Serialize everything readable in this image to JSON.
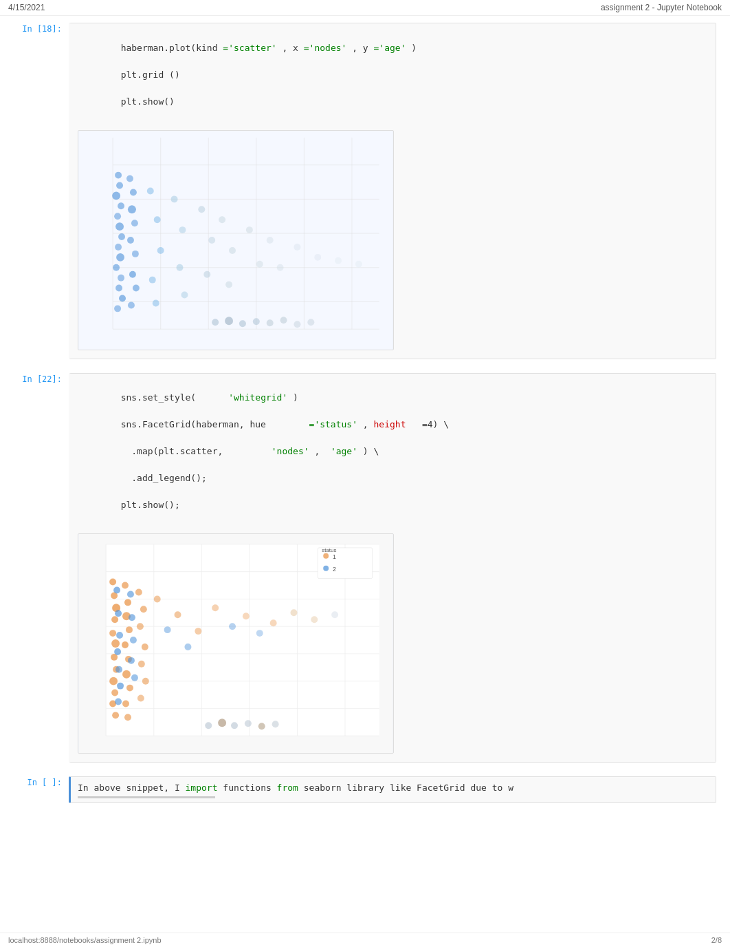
{
  "header": {
    "date": "4/15/2021",
    "title": "assignment 2 - Jupyter Notebook"
  },
  "cells": [
    {
      "id": "cell-18",
      "label": "In [18]:",
      "code_lines": [
        {
          "parts": [
            {
              "text": "haberman.plot(kind",
              "type": "normal"
            },
            {
              "text": " ='scatter'",
              "type": "string"
            },
            {
              "text": " , x ",
              "type": "normal"
            },
            {
              "text": "='nodes'",
              "type": "string"
            },
            {
              "text": " , y ",
              "type": "normal"
            },
            {
              "text": "='age'",
              "type": "string"
            },
            {
              "text": " )",
              "type": "normal"
            }
          ]
        },
        {
          "parts": [
            {
              "text": "plt.grid",
              "type": "normal"
            },
            {
              "text": " ()",
              "type": "normal"
            }
          ]
        },
        {
          "parts": [
            {
              "text": "plt.show()",
              "type": "normal"
            }
          ]
        }
      ],
      "has_output": true,
      "output_type": "scatter_plot_1"
    },
    {
      "id": "cell-22",
      "label": "In [22]:",
      "code_lines": [
        {
          "parts": [
            {
              "text": "sns.set_style(",
              "type": "normal"
            },
            {
              "text": "      'whitegrid'",
              "type": "string"
            },
            {
              "text": " )",
              "type": "normal"
            }
          ]
        },
        {
          "parts": [
            {
              "text": "sns.FacetGrid(haberman, hue",
              "type": "normal"
            },
            {
              "text": "        ='status'",
              "type": "string"
            },
            {
              "text": " , height",
              "type": "normal"
            },
            {
              "text": "   =4) \\",
              "type": "normal"
            }
          ]
        },
        {
          "parts": [
            {
              "text": "  .map(plt.scatter,",
              "type": "normal"
            },
            {
              "text": "         'nodes'",
              "type": "string"
            },
            {
              "text": " ,  ",
              "type": "normal"
            },
            {
              "text": "'age'",
              "type": "string"
            },
            {
              "text": " ) \\",
              "type": "normal"
            }
          ]
        },
        {
          "parts": [
            {
              "text": "  .add_legend();",
              "type": "normal"
            }
          ]
        },
        {
          "parts": [
            {
              "text": "plt.show();",
              "type": "normal"
            }
          ]
        }
      ],
      "has_output": true,
      "output_type": "scatter_plot_2"
    },
    {
      "id": "cell-empty",
      "label": "In [ ]:",
      "code_lines": [
        {
          "parts": [
            {
              "text": "In above snippet, I",
              "type": "normal"
            },
            {
              "text": "    import",
              "type": "import"
            },
            {
              "text": " functions",
              "type": "normal"
            },
            {
              "text": "   from",
              "type": "from"
            },
            {
              "text": "  seaborn library like FacetGrid due to w",
              "type": "normal"
            }
          ]
        }
      ],
      "has_output": false,
      "output_type": null,
      "has_marquee": true
    }
  ],
  "footer": {
    "left": "localhost:8888/notebooks/assignment 2.ipynb",
    "right": "2/8"
  }
}
